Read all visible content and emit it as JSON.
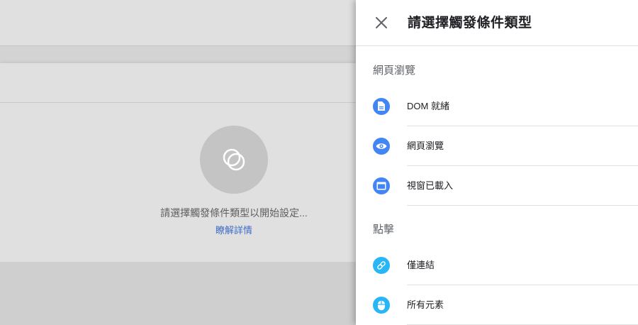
{
  "background": {
    "placeholder_text": "請選擇觸發條件類型以開始設定...",
    "learn_more_link": "瞭解詳情"
  },
  "panel": {
    "title": "請選擇觸發條件類型",
    "close_icon": "close-icon",
    "sections": [
      {
        "heading": "網頁瀏覽",
        "items": [
          {
            "label": "DOM 就緒",
            "icon": "document-icon",
            "color": "#4285f4"
          },
          {
            "label": "網頁瀏覽",
            "icon": "eye-icon",
            "color": "#4285f4"
          },
          {
            "label": "視窗已載入",
            "icon": "window-icon",
            "color": "#4285f4"
          }
        ]
      },
      {
        "heading": "點擊",
        "items": [
          {
            "label": "僅連結",
            "icon": "link-icon",
            "color": "#29b6f6"
          },
          {
            "label": "所有元素",
            "icon": "mouse-icon",
            "color": "#29b6f6"
          }
        ]
      }
    ]
  }
}
